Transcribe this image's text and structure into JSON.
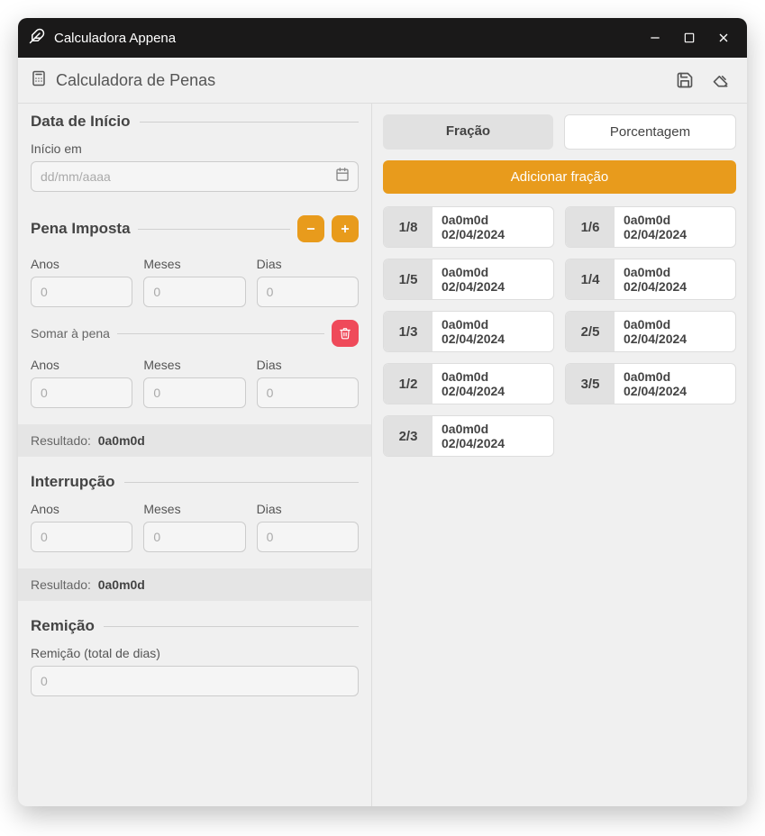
{
  "window": {
    "title": "Calculadora Appena"
  },
  "subheader": {
    "title": "Calculadora de Penas"
  },
  "start": {
    "heading": "Data de Início",
    "label": "Início em",
    "placeholder": "dd/mm/aaaa"
  },
  "pena": {
    "heading": "Pena Imposta",
    "anos_label": "Anos",
    "meses_label": "Meses",
    "dias_label": "Dias",
    "placeholder": "0"
  },
  "somar": {
    "label": "Somar à pena",
    "anos_label": "Anos",
    "meses_label": "Meses",
    "dias_label": "Dias",
    "placeholder": "0",
    "result_label": "Resultado:",
    "result_value": "0a0m0d"
  },
  "interrupcao": {
    "heading": "Interrupção",
    "anos_label": "Anos",
    "meses_label": "Meses",
    "dias_label": "Dias",
    "placeholder": "0",
    "result_label": "Resultado:",
    "result_value": "0a0m0d"
  },
  "remicao": {
    "heading": "Remição",
    "label": "Remição (total de dias)",
    "placeholder": "0"
  },
  "right": {
    "tab_fracao": "Fração",
    "tab_porcentagem": "Porcentagem",
    "add_button": "Adicionar fração",
    "cards": [
      {
        "frac": "1/8",
        "val": "0a0m0d",
        "date": "02/04/2024"
      },
      {
        "frac": "1/6",
        "val": "0a0m0d",
        "date": "02/04/2024"
      },
      {
        "frac": "1/5",
        "val": "0a0m0d",
        "date": "02/04/2024"
      },
      {
        "frac": "1/4",
        "val": "0a0m0d",
        "date": "02/04/2024"
      },
      {
        "frac": "1/3",
        "val": "0a0m0d",
        "date": "02/04/2024"
      },
      {
        "frac": "2/5",
        "val": "0a0m0d",
        "date": "02/04/2024"
      },
      {
        "frac": "1/2",
        "val": "0a0m0d",
        "date": "02/04/2024"
      },
      {
        "frac": "3/5",
        "val": "0a0m0d",
        "date": "02/04/2024"
      },
      {
        "frac": "2/3",
        "val": "0a0m0d",
        "date": "02/04/2024"
      }
    ]
  }
}
